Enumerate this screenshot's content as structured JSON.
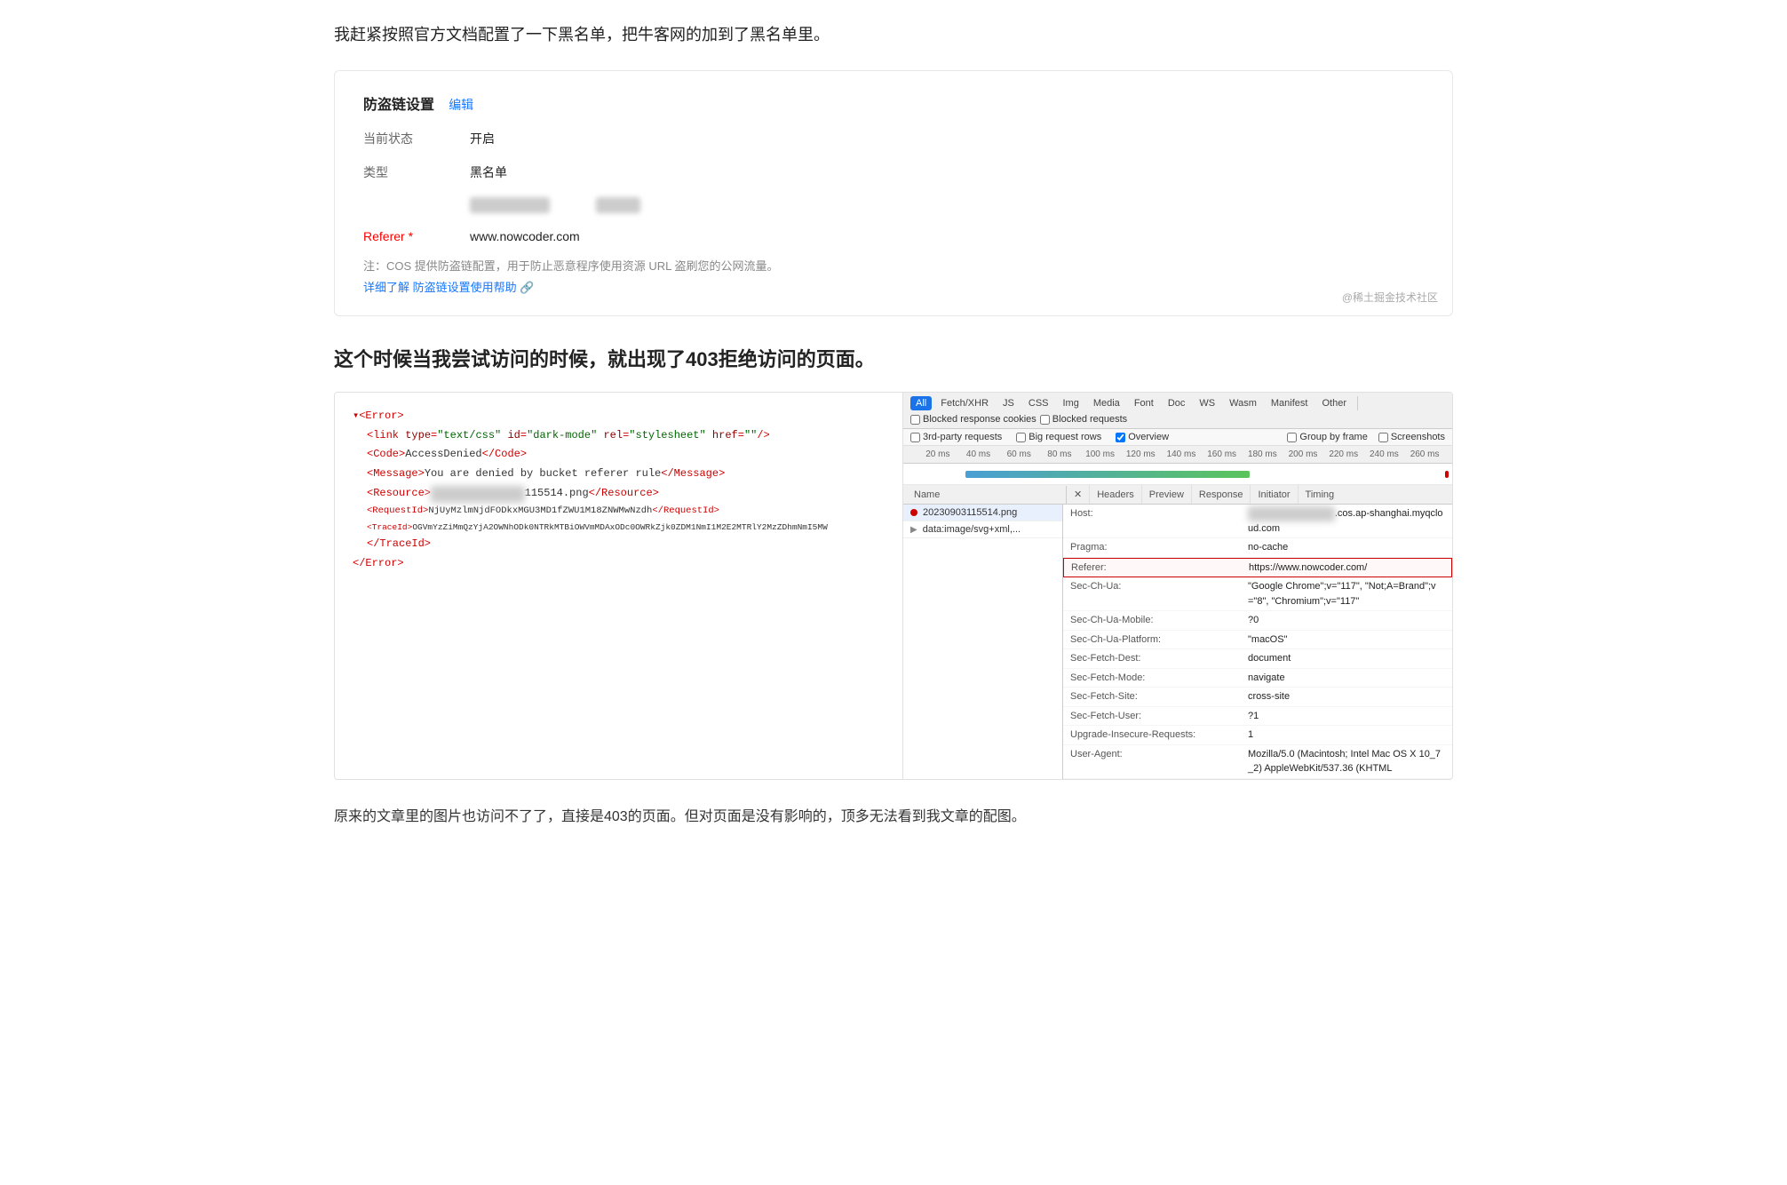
{
  "intro": {
    "text": "我赶紧按照官方文档配置了一下黑名单，把牛客网的加到了黑名单里。"
  },
  "settings": {
    "title": "防盗链设置",
    "edit_label": "编辑",
    "status_label": "当前状态",
    "status_value": "开启",
    "type_label": "类型",
    "type_value": "黑名单",
    "referer_label": "Referer",
    "required_mark": "*",
    "referer_value": "www.nowcoder.com",
    "note_text": "注：COS 提供防盗链配置，用于防止恶意程序使用资源 URL 盗刷您的公网流量。",
    "note_link_text": "详细了解 防盗链设置使用帮助 🔗",
    "watermark": "@稀土掘金技术社区"
  },
  "section2": {
    "title": "这个时候当我尝试访问的时候，就出现了403拒绝访问的页面。"
  },
  "xml_panel": {
    "line1": "▾<Error>",
    "line2": "    <link type=\"text/css\" id=\"dark-mode\" rel=\"stylesheet\" href=\"\"/>",
    "line3": "    <Code>AccessDenied</Code>",
    "line4": "    <Message>You are denied by bucket referer rule</Message>",
    "line5": "    <Resource>",
    "line5_blurred": "              115514.png</Resource>",
    "line6": "    <RequestId>NjUyMzlmNjdFODkxMGU3MD1fZWU1M18ZNWMwNzdh</RequestId>",
    "line7": "    <TraceId>OGVmYzZiMmQzYjA2OWNhODk0NTRkMTBiOWVmMDAxODc0OWRkZjk0ZDM1NmI1M2E2MTRlY2MzZDhmNmI5MW</TraceId>",
    "line8": "    </TraceId>",
    "line9": "</Error>"
  },
  "network_toolbar": {
    "filters": [
      "All",
      "Fetch/XHR",
      "JS",
      "CSS",
      "Img",
      "Media",
      "Font",
      "Doc",
      "WS",
      "Wasm",
      "Manifest",
      "Other"
    ],
    "active_filter": "All",
    "blocked_response": "Blocked response cookies",
    "blocked_requests": "Blocked requests",
    "checkbox_3rd_party": "3rd-party requests",
    "checkbox_big_rows": "Big request rows",
    "checkbox_overview": "Overview",
    "checkbox_group_frame": "Group by frame",
    "checkbox_screenshots": "Screenshots"
  },
  "timeline": {
    "labels": [
      "20 ms",
      "40 ms",
      "60 ms",
      "80 ms",
      "100 ms",
      "120 ms",
      "140 ms",
      "160 ms",
      "180 ms",
      "200 ms",
      "220 ms",
      "240 ms",
      "260 ms"
    ]
  },
  "headers_tabs": [
    "Name",
    "Headers",
    "Preview",
    "Response",
    "Initiator",
    "Timing"
  ],
  "active_headers_tab": "Headers",
  "files": [
    {
      "name": "20230903115514.png",
      "error": true
    },
    {
      "name": "data:image/svg+xml,...",
      "error": false
    }
  ],
  "headers": [
    {
      "name": "Host:",
      "value": "shugat-1307242024.cos.ap-shanghai.myqcloud.com",
      "blurred": false,
      "highlight": false
    },
    {
      "name": "Pragma:",
      "value": "no-cache",
      "blurred": false,
      "highlight": false
    },
    {
      "name": "Referer:",
      "value": "https://www.nowcoder.com/",
      "blurred": false,
      "highlight": true
    },
    {
      "name": "Sec-Ch-Ua:",
      "value": "\"Google Chrome\";v=\"117\", \"Not;A=Brand\";v=\"8\", \"Chromium\";v=\"117\"",
      "blurred": false,
      "highlight": false
    },
    {
      "name": "Sec-Ch-Ua-Mobile:",
      "value": "?0",
      "blurred": false,
      "highlight": false
    },
    {
      "name": "Sec-Ch-Ua-Platform:",
      "value": "\"macOS\"",
      "blurred": false,
      "highlight": false
    },
    {
      "name": "Sec-Fetch-Dest:",
      "value": "document",
      "blurred": false,
      "highlight": false
    },
    {
      "name": "Sec-Fetch-Mode:",
      "value": "navigate",
      "blurred": false,
      "highlight": false
    },
    {
      "name": "Sec-Fetch-Site:",
      "value": "cross-site",
      "blurred": false,
      "highlight": false
    },
    {
      "name": "Sec-Fetch-User:",
      "value": "?1",
      "blurred": false,
      "highlight": false
    },
    {
      "name": "Upgrade-Insecure-Requests:",
      "value": "1",
      "blurred": false,
      "highlight": false
    },
    {
      "name": "User-Agent:",
      "value": "Mozilla/5.0 (Macintosh; Intel Mac OS X 10_7_2) AppleWebKit/537.36 (KHTML",
      "blurred": false,
      "highlight": false
    }
  ],
  "bottom_text": "原来的文章里的图片也访问不了了，直接是403的页面。但对页面是没有影响的，顶多无法看到我文章的配图。"
}
